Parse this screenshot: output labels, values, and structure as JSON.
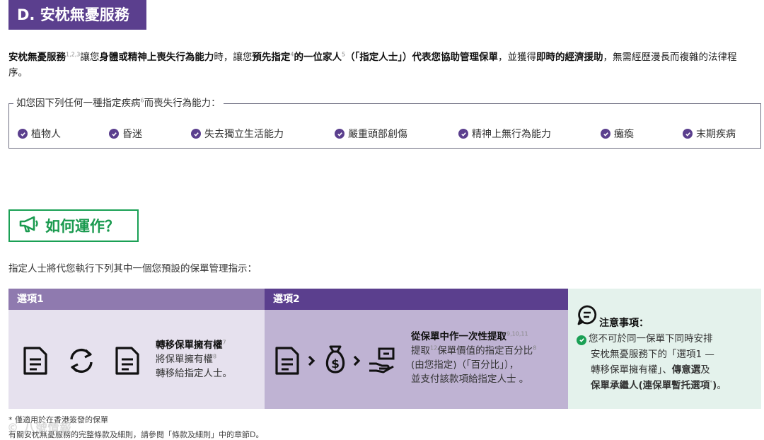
{
  "section": {
    "title": "D. 安枕無憂服務"
  },
  "intro": {
    "service_name": "安枕無憂服務",
    "sup_service": "1,2,3",
    "t1": "讓您",
    "b1": "身體或精神上喪失行為能力",
    "t2": "時，讓您",
    "b2": "預先指定",
    "sup_b2": "4",
    "b3": "的一位家人",
    "sup_b3": "5",
    "b4": "（「指定人士」）代表您協助管理保單",
    "t3": "，並獲得",
    "b5": "即時的經濟援助",
    "t4": "，無需經歷漫長而複雜的法律程序。"
  },
  "conditions": {
    "legend_before": "如您因下列任何一種指定疾病",
    "legend_sup": "6",
    "legend_after": "而喪失行為能力：",
    "items": [
      "植物人",
      "昏迷",
      "失去獨立生活能力",
      "嚴重頭部創傷",
      "精神上無行為能力",
      "癱瘓",
      "末期疾病"
    ]
  },
  "how": {
    "title": "如何運作？"
  },
  "lead": "指定人士將代您執行下列其中一個您預設的保單管理指示：",
  "option1": {
    "label": "選項1",
    "title": "轉移保單擁有權",
    "title_sup": "7",
    "line1": "將保單擁有權",
    "line1_sup": "8",
    "line2": "轉移給指定人士。"
  },
  "option2": {
    "label": "選項2",
    "title": "從保單中作一次性提取",
    "title_sup": "9,10,11",
    "line1_a": "提取",
    "line1_sup": "12",
    "line1_b": "保單價值的指定百分比",
    "line1_sup2": "8",
    "line2": "(由您指定)（「百分比」），",
    "line3": "並支付該款項給指定人士 。"
  },
  "note": {
    "title": "注意事項：",
    "line1": "您不可於同一保單下同時安排",
    "line2": "安枕無憂服務下的「選項1 —",
    "line3": "轉移保單擁有權」、",
    "line3_bold": "傳意選",
    "line3_after": "及",
    "line4_bold": "保單承繼人(連保單暫托選項",
    "line4_sup": "*",
    "line4_after": ")",
    "line4_end": "。"
  },
  "footnotes": {
    "f1": "* 僅適用於在香港簽發的保單",
    "f2": "有關安枕無憂服務的完整條款及細則，請參閱「條款及細則」中的章節D。"
  },
  "watermark": "© 八號情報",
  "colors": {
    "purple": "#5b3f8e",
    "light_purple": "#8f7aaf",
    "green": "#1aa055"
  }
}
